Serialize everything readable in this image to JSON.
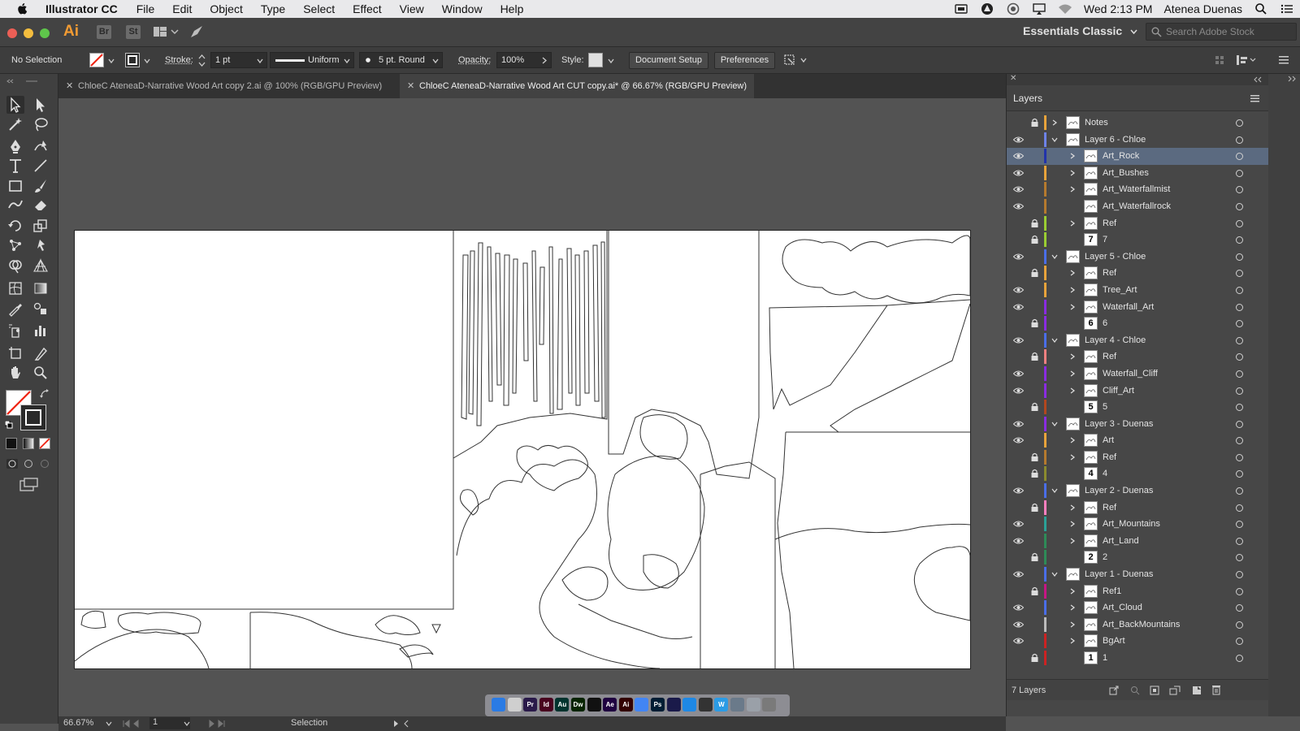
{
  "menubar": {
    "app_name": "Illustrator CC",
    "menus": [
      "File",
      "Edit",
      "Object",
      "Type",
      "Select",
      "Effect",
      "View",
      "Window",
      "Help"
    ],
    "clock": "Wed 2:13 PM",
    "user": "Atenea Duenas"
  },
  "appbar": {
    "logo": "Ai",
    "bridge": "Br",
    "stock": "St",
    "workspace": "Essentials Classic",
    "search_placeholder": "Search Adobe Stock"
  },
  "controlbar": {
    "selection": "No Selection",
    "stroke_label": "Stroke:",
    "stroke_value": "1 pt",
    "profile": "Uniform",
    "brush": "5 pt. Round",
    "opacity_label": "Opacity:",
    "opacity_value": "100%",
    "style_label": "Style:",
    "document_setup": "Document Setup",
    "preferences": "Preferences"
  },
  "tabs": [
    {
      "label": "ChloeC AteneaD-Narrative Wood Art copy 2.ai @ 100% (RGB/GPU Preview)",
      "active": false
    },
    {
      "label": "ChloeC AteneaD-Narrative Wood Art CUT copy.ai* @ 66.67% (RGB/GPU Preview)",
      "active": true
    }
  ],
  "status": {
    "zoom": "66.67%",
    "artboard": "1",
    "tool": "Selection"
  },
  "layers_panel": {
    "title": "Layers",
    "count": "7 Layers",
    "rows": [
      {
        "name": "Notes",
        "level": 0,
        "visible": false,
        "locked": true,
        "color": "#e8a33b",
        "expand": "collapsed",
        "thumb": "img"
      },
      {
        "name": "Layer 6 - Chloe",
        "level": 0,
        "visible": true,
        "locked": false,
        "color": "#6e83e8",
        "expand": "expanded",
        "thumb": "img"
      },
      {
        "name": "Art_Rock",
        "level": 1,
        "visible": true,
        "locked": false,
        "color": "#2233aa",
        "expand": "collapsed",
        "thumb": "img",
        "selected": true
      },
      {
        "name": "Art_Bushes",
        "level": 1,
        "visible": true,
        "locked": false,
        "color": "#e8a33b",
        "expand": "collapsed",
        "thumb": "img"
      },
      {
        "name": "Art_Waterfallmist",
        "level": 1,
        "visible": true,
        "locked": false,
        "color": "#b57a2e",
        "expand": "collapsed",
        "thumb": "img"
      },
      {
        "name": "Art_Waterfallrock",
        "level": 1,
        "visible": true,
        "locked": false,
        "color": "#b57a2e",
        "expand": "none",
        "thumb": "img"
      },
      {
        "name": "Ref",
        "level": 1,
        "visible": false,
        "locked": true,
        "color": "#9acd32",
        "expand": "collapsed",
        "thumb": "img"
      },
      {
        "name": "7",
        "level": 1,
        "visible": false,
        "locked": true,
        "color": "#9acd32",
        "expand": "none",
        "thumb": "7"
      },
      {
        "name": "Layer 5 - Chloe",
        "level": 0,
        "visible": true,
        "locked": false,
        "color": "#4a6ee8",
        "expand": "expanded",
        "thumb": "img"
      },
      {
        "name": "Ref",
        "level": 1,
        "visible": false,
        "locked": true,
        "color": "#e8a33b",
        "expand": "collapsed",
        "thumb": "img"
      },
      {
        "name": "Tree_Art",
        "level": 1,
        "visible": true,
        "locked": false,
        "color": "#e8a33b",
        "expand": "collapsed",
        "thumb": "img"
      },
      {
        "name": "Waterfall_Art",
        "level": 1,
        "visible": true,
        "locked": false,
        "color": "#8a2be2",
        "expand": "collapsed",
        "thumb": "img"
      },
      {
        "name": "6",
        "level": 1,
        "visible": false,
        "locked": true,
        "color": "#8a2be2",
        "expand": "none",
        "thumb": "6"
      },
      {
        "name": "Layer 4 - Chloe",
        "level": 0,
        "visible": true,
        "locked": false,
        "color": "#4a6ee8",
        "expand": "expanded",
        "thumb": "img"
      },
      {
        "name": "Ref",
        "level": 1,
        "visible": false,
        "locked": true,
        "color": "#f08080",
        "expand": "collapsed",
        "thumb": "img"
      },
      {
        "name": "Waterfall_Cliff",
        "level": 1,
        "visible": true,
        "locked": false,
        "color": "#8a2be2",
        "expand": "collapsed",
        "thumb": "img"
      },
      {
        "name": "Cliff_Art",
        "level": 1,
        "visible": true,
        "locked": false,
        "color": "#8a2be2",
        "expand": "collapsed",
        "thumb": "img"
      },
      {
        "name": "5",
        "level": 1,
        "visible": false,
        "locked": true,
        "color": "#b2471e",
        "expand": "none",
        "thumb": "5"
      },
      {
        "name": "Layer 3 - Duenas",
        "level": 0,
        "visible": true,
        "locked": false,
        "color": "#8a2be2",
        "expand": "expanded",
        "thumb": "img"
      },
      {
        "name": "Art",
        "level": 1,
        "visible": true,
        "locked": false,
        "color": "#e8a33b",
        "expand": "collapsed",
        "thumb": "img"
      },
      {
        "name": "Ref",
        "level": 1,
        "visible": false,
        "locked": true,
        "color": "#b57a2e",
        "expand": "collapsed",
        "thumb": "img"
      },
      {
        "name": "4",
        "level": 1,
        "visible": false,
        "locked": true,
        "color": "#8b8b2e",
        "expand": "none",
        "thumb": "4"
      },
      {
        "name": "Layer 2 - Duenas",
        "level": 0,
        "visible": true,
        "locked": false,
        "color": "#4a6ee8",
        "expand": "expanded",
        "thumb": "img"
      },
      {
        "name": "Ref",
        "level": 1,
        "visible": false,
        "locked": true,
        "color": "#ff7fbf",
        "expand": "collapsed",
        "thumb": "img"
      },
      {
        "name": "Art_Mountains",
        "level": 1,
        "visible": true,
        "locked": false,
        "color": "#2aa198",
        "expand": "collapsed",
        "thumb": "img"
      },
      {
        "name": "Art_Land",
        "level": 1,
        "visible": true,
        "locked": false,
        "color": "#2e8b57",
        "expand": "collapsed",
        "thumb": "img"
      },
      {
        "name": "2",
        "level": 1,
        "visible": false,
        "locked": true,
        "color": "#2e8b57",
        "expand": "none",
        "thumb": "2"
      },
      {
        "name": "Layer 1 - Duenas",
        "level": 0,
        "visible": true,
        "locked": false,
        "color": "#4a6ee8",
        "expand": "expanded",
        "thumb": "img"
      },
      {
        "name": "Ref1",
        "level": 1,
        "visible": false,
        "locked": true,
        "color": "#c71585",
        "expand": "collapsed",
        "thumb": "img"
      },
      {
        "name": "Art_Cloud",
        "level": 1,
        "visible": true,
        "locked": false,
        "color": "#4a6ee8",
        "expand": "collapsed",
        "thumb": "img"
      },
      {
        "name": "Art_BackMountains",
        "level": 1,
        "visible": true,
        "locked": false,
        "color": "#bbbbbb",
        "expand": "collapsed",
        "thumb": "img"
      },
      {
        "name": "BgArt",
        "level": 1,
        "visible": true,
        "locked": false,
        "color": "#cc2222",
        "expand": "collapsed",
        "thumb": "img"
      },
      {
        "name": "1",
        "level": 1,
        "visible": false,
        "locked": true,
        "color": "#cc2222",
        "expand": "none",
        "thumb": "1"
      }
    ]
  },
  "dock": {
    "apps": [
      {
        "label": "",
        "color": "#2a7be4"
      },
      {
        "label": "",
        "color": "#cfcfcf"
      },
      {
        "label": "Pr",
        "color": "#2a1a4a"
      },
      {
        "label": "Id",
        "color": "#49021f"
      },
      {
        "label": "Au",
        "color": "#00332e"
      },
      {
        "label": "Dw",
        "color": "#072401"
      },
      {
        "label": "",
        "color": "#111111"
      },
      {
        "label": "Ae",
        "color": "#1f0040"
      },
      {
        "label": "Ai",
        "color": "#330000"
      },
      {
        "label": "",
        "color": "#4285f4"
      },
      {
        "label": "Ps",
        "color": "#001d34"
      },
      {
        "label": "",
        "color": "#1a1a4a"
      },
      {
        "label": "",
        "color": "#1e88e5"
      },
      {
        "label": "",
        "color": "#333333"
      },
      {
        "label": "W",
        "color": "#2b9be5"
      },
      {
        "label": "",
        "color": "#6a7a8a"
      },
      {
        "label": "",
        "color": "#9aa0a8"
      },
      {
        "label": "",
        "color": "#7a7a7a"
      }
    ]
  }
}
